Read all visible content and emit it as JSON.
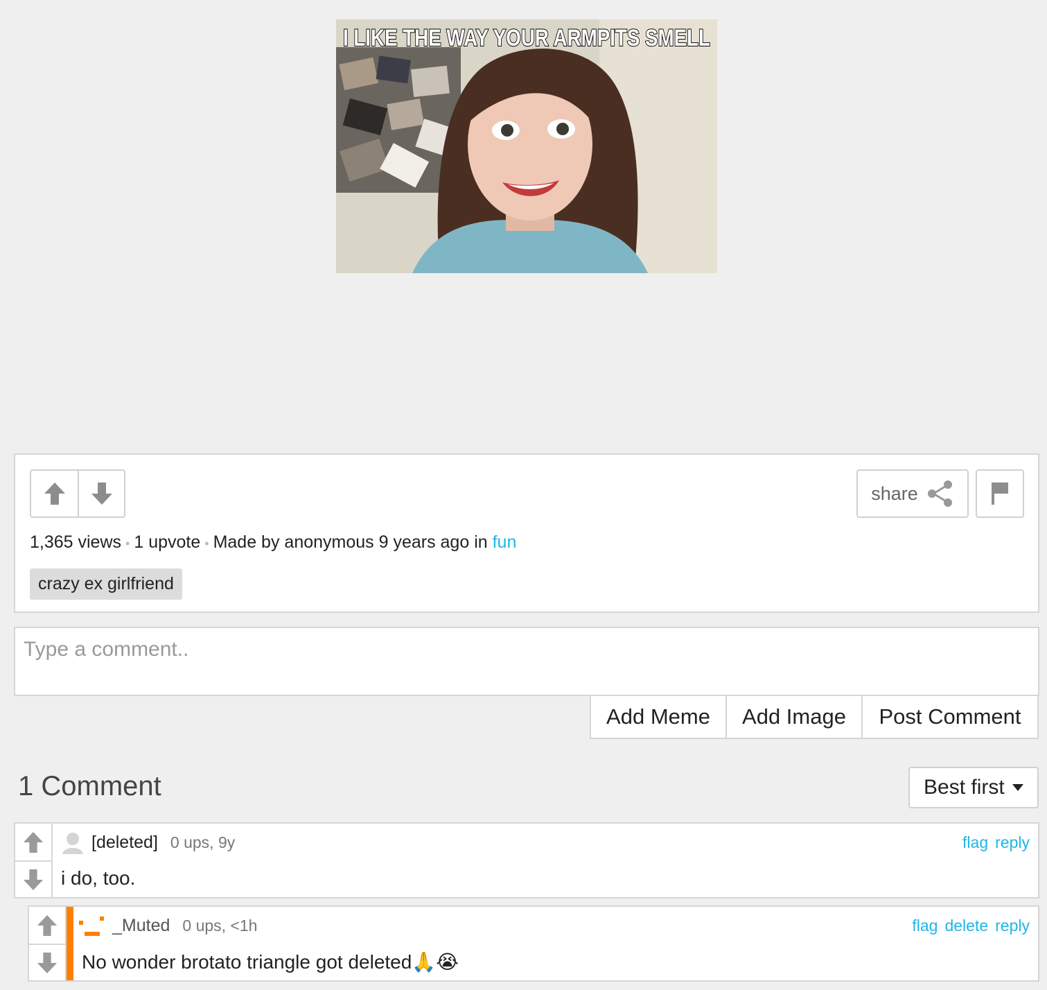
{
  "meme": {
    "caption": "I LIKE THE WAY YOUR ARMPITS SMELL"
  },
  "post": {
    "views": "1,365 views",
    "upvotes": "1 upvote",
    "made_by": "Made by anonymous 9 years ago in",
    "stream": "fun",
    "share_label": "share",
    "tag": "crazy ex girlfriend"
  },
  "comment_form": {
    "placeholder": "Type a comment..",
    "add_meme": "Add Meme",
    "add_image": "Add Image",
    "post_comment": "Post Comment"
  },
  "comments_header": {
    "count": "1 Comment",
    "sort": "Best first"
  },
  "comments": [
    {
      "user": "[deleted]",
      "stats": "0 ups, 9y",
      "text": "i do, too.",
      "actions": [
        "flag",
        "reply"
      ]
    },
    {
      "user": "_Muted",
      "stats": "0 ups, <1h",
      "text": "No wonder brotato triangle got deleted",
      "emoji": "🙏😭",
      "actions": [
        "flag",
        "delete",
        "reply"
      ],
      "accent_color": "#ff8000"
    }
  ]
}
